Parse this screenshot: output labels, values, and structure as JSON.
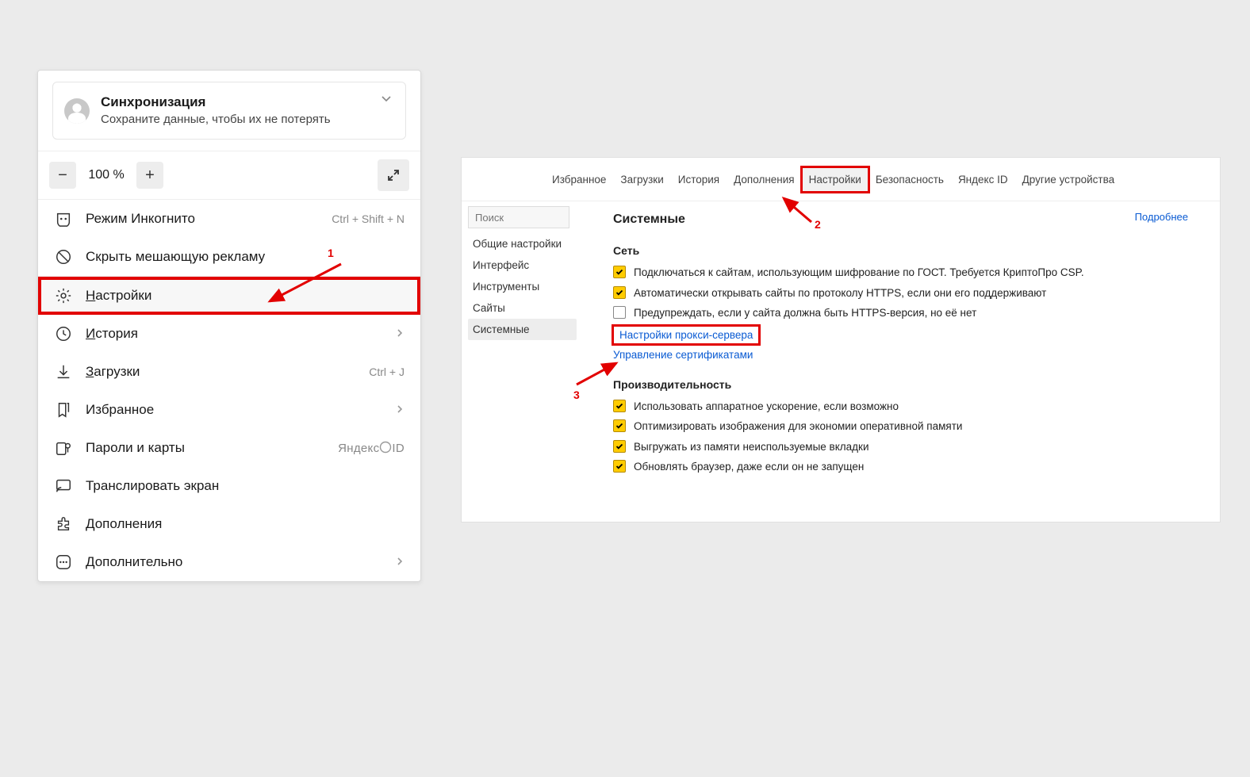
{
  "menu": {
    "sync": {
      "title": "Синхронизация",
      "subtitle": "Сохраните данные, чтобы их не потерять"
    },
    "zoom": {
      "level": "100 %"
    },
    "items": {
      "incognito": {
        "label": "Режим Инкогнито",
        "shortcut": "Ctrl + Shift + N"
      },
      "hide_ads": {
        "label": "Скрыть мешающую рекламу"
      },
      "settings": {
        "label": "Настройки"
      },
      "history": {
        "label": "История"
      },
      "downloads": {
        "label": "Загрузки",
        "shortcut": "Ctrl + J"
      },
      "bookmarks": {
        "label": "Избранное"
      },
      "passwords": {
        "label": "Пароли и карты",
        "tag": "Яндекс ID"
      },
      "cast": {
        "label": "Транслировать экран"
      },
      "extensions": {
        "label": "Дополнения"
      },
      "more": {
        "label": "Дополнительно"
      }
    }
  },
  "settings_page": {
    "tabs": {
      "favorites": "Избранное",
      "downloads": "Загрузки",
      "history": "История",
      "addons": "Дополнения",
      "settings": "Настройки",
      "security": "Безопасность",
      "yandex_id": "Яндекс ID",
      "other_dev": "Другие устройства"
    },
    "side": {
      "search_placeholder": "Поиск",
      "general": "Общие настройки",
      "interface": "Интерфейс",
      "tools": "Инструменты",
      "sites": "Сайты",
      "system": "Системные"
    },
    "content": {
      "page_title": "Системные",
      "more_link": "Подробнее",
      "net_section": "Сеть",
      "net_gost": "Подключаться к сайтам, использующим шифрование по ГОСТ. Требуется КриптоПро CSP.",
      "net_https": "Автоматически открывать сайты по протоколу HTTPS, если они его поддерживают",
      "net_warn": "Предупреждать, если у сайта должна быть HTTPS-версия, но её нет",
      "net_proxy": "Настройки прокси-сервера",
      "net_certs": "Управление сертификатами",
      "perf_section": "Производительность",
      "perf_hw": "Использовать аппаратное ускорение, если возможно",
      "perf_img": "Оптимизировать изображения для экономии оперативной памяти",
      "perf_unload": "Выгружать из памяти неиспользуемые вкладки",
      "perf_update": "Обновлять браузер, даже если он не запущен"
    }
  },
  "annotations": {
    "n1": "1",
    "n2": "2",
    "n3": "3"
  }
}
